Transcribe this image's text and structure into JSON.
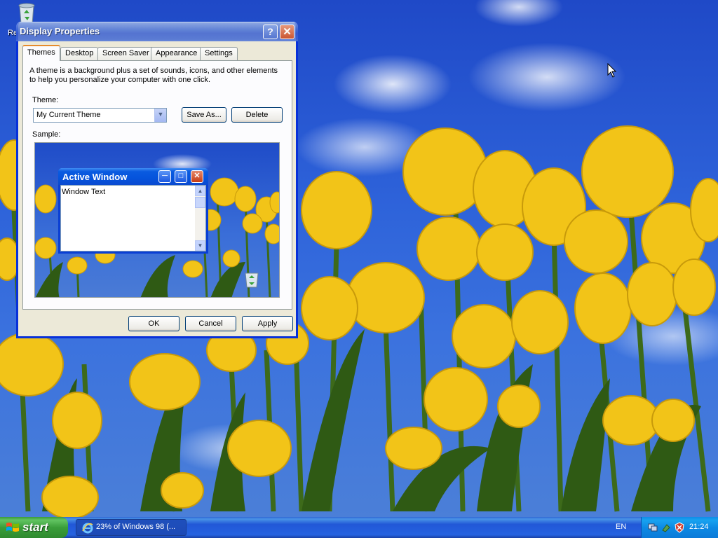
{
  "desktop": {
    "icons": [
      {
        "name": "Recycle Bin",
        "label": "Re"
      }
    ]
  },
  "window": {
    "title": "Display Properties",
    "help_label": "?",
    "close_label": "✕",
    "tabs": [
      {
        "label": "Themes",
        "active": true
      },
      {
        "label": "Desktop",
        "active": false
      },
      {
        "label": "Screen Saver",
        "active": false
      },
      {
        "label": "Appearance",
        "active": false
      },
      {
        "label": "Settings",
        "active": false
      }
    ],
    "description": "A theme is a background plus a set of sounds, icons, and other elements to help you personalize your computer with one click.",
    "theme_label": "Theme:",
    "theme_value": "My Current Theme",
    "save_as_label": "Save As...",
    "delete_label": "Delete",
    "sample_label": "Sample:",
    "sample": {
      "window_title": "Active Window",
      "window_text": "Window Text"
    },
    "ok_label": "OK",
    "cancel_label": "Cancel",
    "apply_label": "Apply"
  },
  "taskbar": {
    "start_label": "start",
    "task_label": "23% of Windows 98 (...",
    "language": "EN",
    "clock": "21:24"
  },
  "colors": {
    "title_blue": "#0a5be0",
    "panel_bg": "#ece9d8",
    "start_green": "#3a9e3a",
    "taskbar_blue": "#2157d7"
  }
}
